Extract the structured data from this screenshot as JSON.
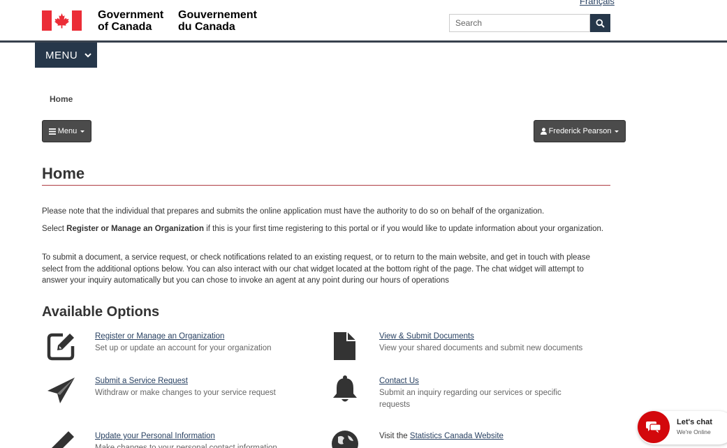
{
  "header": {
    "language_link": "Français",
    "signature_en": [
      "Government",
      "of Canada"
    ],
    "signature_fr": [
      "Gouvernement",
      "du Canada"
    ],
    "search_placeholder": "Search"
  },
  "site_menu": {
    "label": "MENU"
  },
  "breadcrumb": {
    "current": "Home"
  },
  "toolbar": {
    "menu_label": "Menu",
    "user_label": "Frederick Pearson"
  },
  "page": {
    "title": "Home",
    "p1": "Please note that the individual that prepares and submits the online application must have the authority to do so on behalf of the organization.",
    "p2_before": "Select ",
    "p2_bold": "Register or Manage an Organization",
    "p2_after": " if this is your first time registering to this portal or if you would like to update information about your organization.",
    "p3": "To submit a document, a service request, or check notifications related to an existing request, or to return to the main website, and get in touch with please select from the additional options below. You can also interact with our chat widget located at the bottom right of the page. The chat widget will attempt to answer your inquiry automatically but you can chose to invoke an agent at any point during our hours of operations"
  },
  "options": {
    "heading": "Available Options",
    "register": {
      "link": "Register or Manage an Organization",
      "desc": "Set up or update an account for your organization",
      "icon": "edit-square-icon"
    },
    "documents": {
      "link": "View & Submit Documents",
      "desc": "View your shared documents and submit new documents",
      "icon": "document-icon"
    },
    "service": {
      "link": "Submit a Service Request",
      "desc": "Withdraw or make changes to your service request",
      "icon": "paper-plane-icon"
    },
    "contact": {
      "link": "Contact Us",
      "desc": "Submit an inquiry regarding our services or specific requests",
      "icon": "bell-icon"
    },
    "personal": {
      "link": "Update your Personal Information",
      "desc": "Make changes to your personal contact information",
      "icon": "pencil-icon"
    },
    "visit": {
      "prefix": "Visit the ",
      "link": "Statistics Canada Website",
      "icon": "globe-icon"
    }
  },
  "chat": {
    "title": "Let's chat",
    "subtitle": "We're Online"
  },
  "colors": {
    "brand_dark": "#26374a",
    "rule_red": "#af3c43",
    "flag_red": "#eb2d37",
    "chat_red": "#d3080c",
    "link": "#284162"
  }
}
